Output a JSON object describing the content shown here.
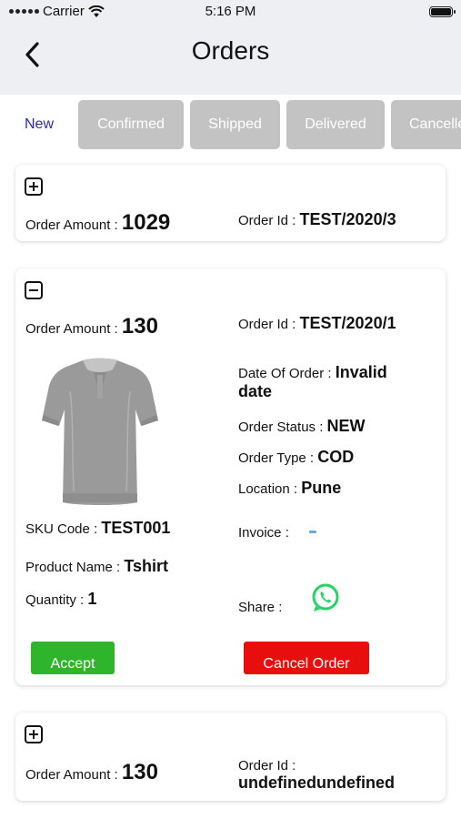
{
  "status_bar": {
    "carrier": "Carrier",
    "time": "5:16 PM"
  },
  "header": {
    "title": "Orders"
  },
  "tabs": [
    {
      "label": "New",
      "active": true
    },
    {
      "label": "Confirmed",
      "active": false
    },
    {
      "label": "Shipped",
      "active": false
    },
    {
      "label": "Delivered",
      "active": false
    },
    {
      "label": "Cancelled",
      "active": false
    }
  ],
  "orders": [
    {
      "expanded": false,
      "amount_label": "Order Amount : ",
      "amount": "1029",
      "id_label": "Order Id : ",
      "id": "TEST/2020/3"
    },
    {
      "expanded": true,
      "amount_label": "Order Amount : ",
      "amount": "130",
      "id_label": "Order Id : ",
      "id": "TEST/2020/1",
      "date_label": "Date Of Order : ",
      "date_line1": "Invalid",
      "date_line2": "date",
      "status_label": "Order Status : ",
      "status": "NEW",
      "type_label": "Order Type : ",
      "type": "COD",
      "location_label": "Location : ",
      "location": "Pune",
      "sku_label": "SKU Code : ",
      "sku": "TEST001",
      "product_label": "Product Name : ",
      "product": "Tshirt",
      "quantity_label": "Quantity : ",
      "quantity": "1",
      "invoice_label": "Invoice : ",
      "share_label": "Share : ",
      "share_icon": "whatsapp-icon",
      "product_image_icon": "grey-polo-tshirt",
      "accept_label": "Accept",
      "cancel_label": "Cancel Order"
    },
    {
      "expanded": false,
      "amount_label": "Order Amount : ",
      "amount": "130",
      "id_label": "Order Id : ",
      "id": "undefinedundefined"
    }
  ],
  "colors": {
    "active_tab_text": "#2a2a9e",
    "inactive_tab_bg": "#c3c3c3",
    "accept": "#2fb52c",
    "cancel": "#e80e0e",
    "whatsapp": "#25d366",
    "header_bg": "#eeeff2"
  }
}
